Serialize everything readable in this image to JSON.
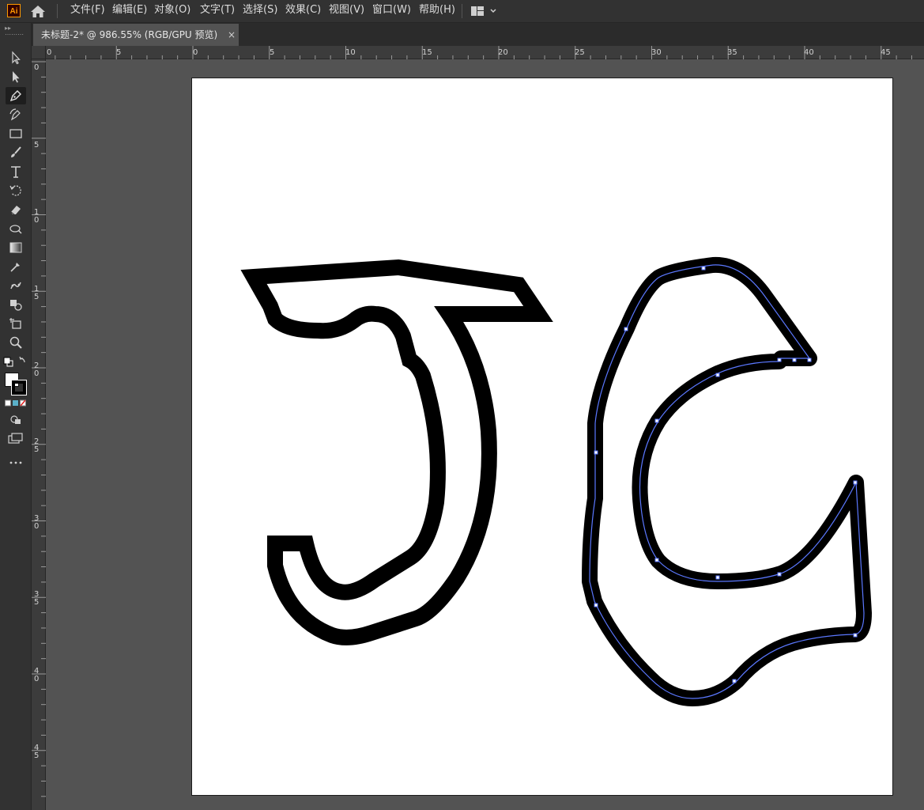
{
  "app": {
    "logo": "Ai"
  },
  "menus": [
    {
      "name": "file",
      "label": "文件(F)"
    },
    {
      "name": "edit",
      "label": "编辑(E)"
    },
    {
      "name": "object",
      "label": "对象(O)"
    },
    {
      "name": "type",
      "label": "文字(T)"
    },
    {
      "name": "select",
      "label": "选择(S)"
    },
    {
      "name": "effect",
      "label": "效果(C)"
    },
    {
      "name": "view",
      "label": "视图(V)"
    },
    {
      "name": "window",
      "label": "窗口(W)"
    },
    {
      "name": "help",
      "label": "帮助(H)"
    }
  ],
  "document_tab": {
    "title": "未标题-2* @ 986.55% (RGB/GPU 预览)",
    "close": "×"
  },
  "ruler_h": [
    "0",
    "5",
    "0",
    "5",
    "10",
    "15",
    "20",
    "25",
    "30",
    "35",
    "40",
    "45"
  ],
  "ruler_v": [
    [
      "0"
    ],
    [
      "5"
    ],
    [
      "1",
      "0"
    ],
    [
      "1",
      "5"
    ],
    [
      "2",
      "0"
    ],
    [
      "2",
      "5"
    ],
    [
      "3",
      "0"
    ],
    [
      "3",
      "5"
    ],
    [
      "4",
      "0"
    ],
    [
      "4",
      "5"
    ]
  ],
  "tools": [
    {
      "name": "selection-tool",
      "icon": "arrow-icon"
    },
    {
      "name": "direct-selection-tool",
      "icon": "direct-arrow-icon"
    },
    {
      "name": "pen-tool",
      "icon": "pen-icon",
      "active": true
    },
    {
      "name": "curvature-tool",
      "icon": "curvature-icon"
    },
    {
      "name": "rectangle-tool",
      "icon": "rectangle-icon"
    },
    {
      "name": "paintbrush-tool",
      "icon": "brush-icon"
    },
    {
      "name": "type-tool",
      "icon": "type-icon"
    },
    {
      "name": "rotate-tool",
      "icon": "rotate-icon"
    },
    {
      "name": "eraser-tool",
      "icon": "eraser-icon"
    },
    {
      "name": "warp-tool",
      "icon": "warp-icon"
    },
    {
      "name": "gradient-tool",
      "icon": "gradient-icon"
    },
    {
      "name": "eyedropper-tool",
      "icon": "eyedropper-icon"
    },
    {
      "name": "puppet-warp-tool",
      "icon": "puppet-icon"
    },
    {
      "name": "shape-builder-tool",
      "icon": "shape-builder-icon"
    },
    {
      "name": "artboard-tool",
      "icon": "artboard-icon"
    },
    {
      "name": "zoom-tool",
      "icon": "zoom-icon"
    }
  ],
  "colors": {
    "accent_logo": "#ff9a00",
    "path_highlight": "#4f6fff",
    "stroke": "#000000"
  }
}
